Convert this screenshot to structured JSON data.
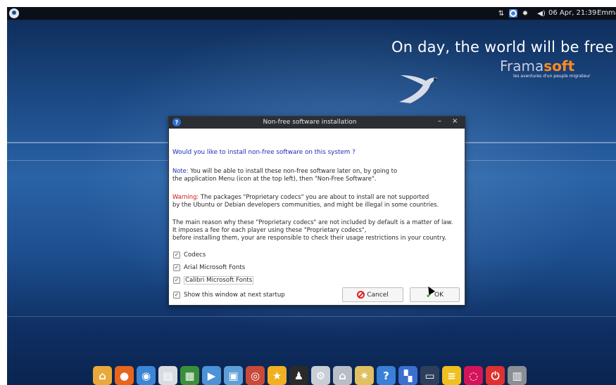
{
  "top_panel": {
    "clock": "06 Apr, 21:39",
    "user": "Emma",
    "icons": [
      "distro-logo-icon",
      "network-icon",
      "updates-icon",
      "settings-icon",
      "volume-icon"
    ]
  },
  "wallpaper": {
    "slogan": "On day, the world will be free !",
    "brand_part1": "Frama",
    "brand_part2": "soft",
    "brand_sub": "les aventures d'un peuple migrateur"
  },
  "dialog": {
    "title": "Non-free software installation",
    "minimize": "–",
    "close": "×",
    "question": "Would you like to install non-free software on this system ?",
    "note_label": "Note:",
    "note_line1": " You will be able to install these non-free software later on, by going to",
    "note_line2": "the application Menu (icon at the top left), then \"Non-Free Software\".",
    "warning_label": "Warning:",
    "warning_line1": " The packages \"Proprietary codecs\" you are about to install are not supported",
    "warning_line2": "by the Ubuntu or Debian developers communities, and might be illegal in some countries.",
    "main_line1": "The main reason why these \"Proprietary codecs\" are not included by default is a matter of law.",
    "main_line2": "It imposes a fee for each player using these \"Proprietary codecs\",",
    "main_line3": "before installing them, your are responsible to check their usage restrictions in your country.",
    "checkboxes": [
      {
        "label": "Codecs",
        "checked": true
      },
      {
        "label": "Arial Microsoft Fonts",
        "checked": true
      },
      {
        "label": "Calibri Microsoft Fonts",
        "checked": true
      }
    ],
    "startup_label": "Show this window at next startup",
    "startup_checked": true,
    "cancel_label": "Cancel",
    "ok_label": "OK"
  },
  "dock": {
    "items": [
      {
        "name": "home-icon",
        "color": "#e8a93a",
        "glyph": "⌂"
      },
      {
        "name": "firefox-icon",
        "color": "#e8651f",
        "glyph": "●"
      },
      {
        "name": "network-browser-icon",
        "color": "#3c86d8",
        "glyph": "◉"
      },
      {
        "name": "document-icon",
        "color": "#d9dde3",
        "glyph": "▤"
      },
      {
        "name": "terminal-icon",
        "color": "#3b8f3b",
        "glyph": "▦"
      },
      {
        "name": "video-editor-icon",
        "color": "#4b92d6",
        "glyph": "▶"
      },
      {
        "name": "image-viewer-icon",
        "color": "#5f9fd8",
        "glyph": "▣"
      },
      {
        "name": "media-player-icon",
        "color": "#c94a3a",
        "glyph": "◎"
      },
      {
        "name": "favorites-star-icon",
        "color": "#f0b020",
        "glyph": "★"
      },
      {
        "name": "linux-tux-icon",
        "color": "#2a2a2a",
        "glyph": "♟"
      },
      {
        "name": "settings-gears-icon",
        "color": "#c9ced6",
        "glyph": "⚙"
      },
      {
        "name": "house-settings-icon",
        "color": "#b9bec6",
        "glyph": "⌂"
      },
      {
        "name": "tools-icon",
        "color": "#e0c060",
        "glyph": "✷"
      },
      {
        "name": "help-icon",
        "color": "#3a7fd8",
        "glyph": "?"
      },
      {
        "name": "workspace-icon",
        "color": "#3b6fd0",
        "glyph": "▚"
      },
      {
        "name": "window-icon",
        "color": "#2d3f5c",
        "glyph": "▭"
      },
      {
        "name": "notes-icon",
        "color": "#f0c020",
        "glyph": "≡"
      },
      {
        "name": "debian-icon",
        "color": "#d4145a",
        "glyph": "◌"
      },
      {
        "name": "power-icon",
        "color": "#e03030",
        "glyph": "⏻"
      },
      {
        "name": "trash-icon",
        "color": "#8a8f96",
        "glyph": "▥"
      }
    ]
  }
}
